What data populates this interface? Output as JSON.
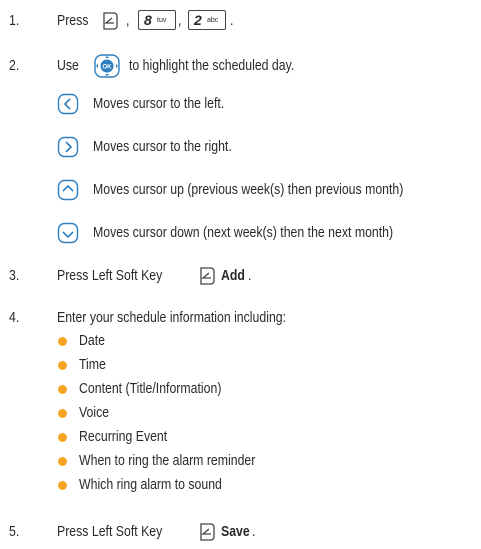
{
  "steps": {
    "s1": {
      "num": "1.",
      "text": "Press",
      "sep1": ",",
      "sep2": ",",
      "end": ".",
      "key1_glyph": "8",
      "key1_sub": "tuv",
      "key2_glyph": "2",
      "key2_sub": "abc"
    },
    "s2": {
      "num": "2.",
      "text_pre": "Use",
      "text_post": "to highlight the scheduled day.",
      "ok_label": "OK"
    },
    "s3": {
      "num": "3.",
      "text": "Press Left Soft Key",
      "bold": "Add",
      "end": "."
    },
    "s4": {
      "num": "4.",
      "text": "Enter your schedule information including:"
    },
    "s5": {
      "num": "5.",
      "text": "Press Left Soft Key",
      "bold": "Save",
      "end": "."
    }
  },
  "nav": [
    {
      "icon": "nav-left-icon",
      "text": "Moves cursor to the left."
    },
    {
      "icon": "nav-right-icon",
      "text": "Moves cursor to the right."
    },
    {
      "icon": "nav-up-icon",
      "text": "Moves cursor up (previous week(s) then previous month)"
    },
    {
      "icon": "nav-down-icon",
      "text": "Moves cursor down (next week(s) then the next month)"
    }
  ],
  "bullets": [
    "Date",
    "Time",
    "Content (Title/Information)",
    "Voice",
    "Recurring Event",
    "When to ring the alarm reminder",
    "Which ring alarm to sound"
  ],
  "colors": {
    "bullet": "#f5a623",
    "icon_stroke": "#2f7fbf",
    "text": "#2a2a2a"
  }
}
